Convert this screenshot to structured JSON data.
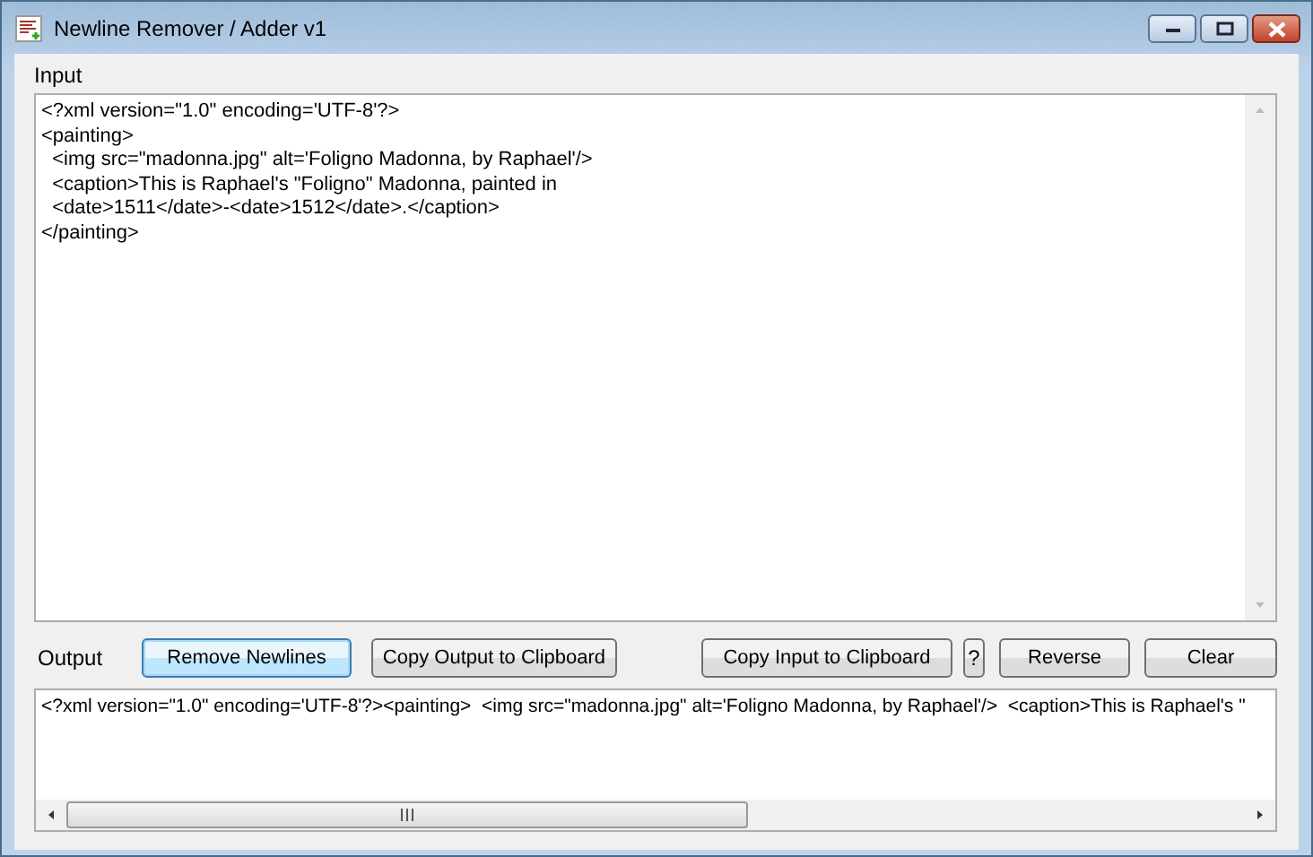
{
  "window": {
    "title": "Newline Remover / Adder v1"
  },
  "input": {
    "label": "Input",
    "lines": [
      "<?xml version=\"1.0\" encoding='UTF-8'?>",
      "<painting>",
      "  <img src=\"madonna.jpg\" alt='Foligno Madonna, by Raphael'/>",
      "  <caption>This is Raphael's \"Foligno\" Madonna, painted in",
      "  <date>1511</date>-<date>1512</date>.</caption>",
      "</painting>"
    ]
  },
  "output": {
    "label": "Output",
    "text": "<?xml version=\"1.0\" encoding='UTF-8'?><painting>  <img src=\"madonna.jpg\" alt='Foligno Madonna, by Raphael'/>  <caption>This is Raphael's \""
  },
  "buttons": [
    {
      "kind": "wide",
      "label": "Remove Newlines",
      "focused": true
    },
    {
      "kind": "wide",
      "label": "Copy Output to Clipboard",
      "focused": false
    },
    {
      "kind": "gap"
    },
    {
      "kind": "wide",
      "label": "Copy Input to Clipboard",
      "focused": false
    },
    {
      "kind": "small",
      "label": "?",
      "focused": false
    },
    {
      "kind": "wide",
      "label": "Reverse",
      "focused": false
    },
    {
      "kind": "wide",
      "label": "Clear",
      "focused": false
    }
  ]
}
